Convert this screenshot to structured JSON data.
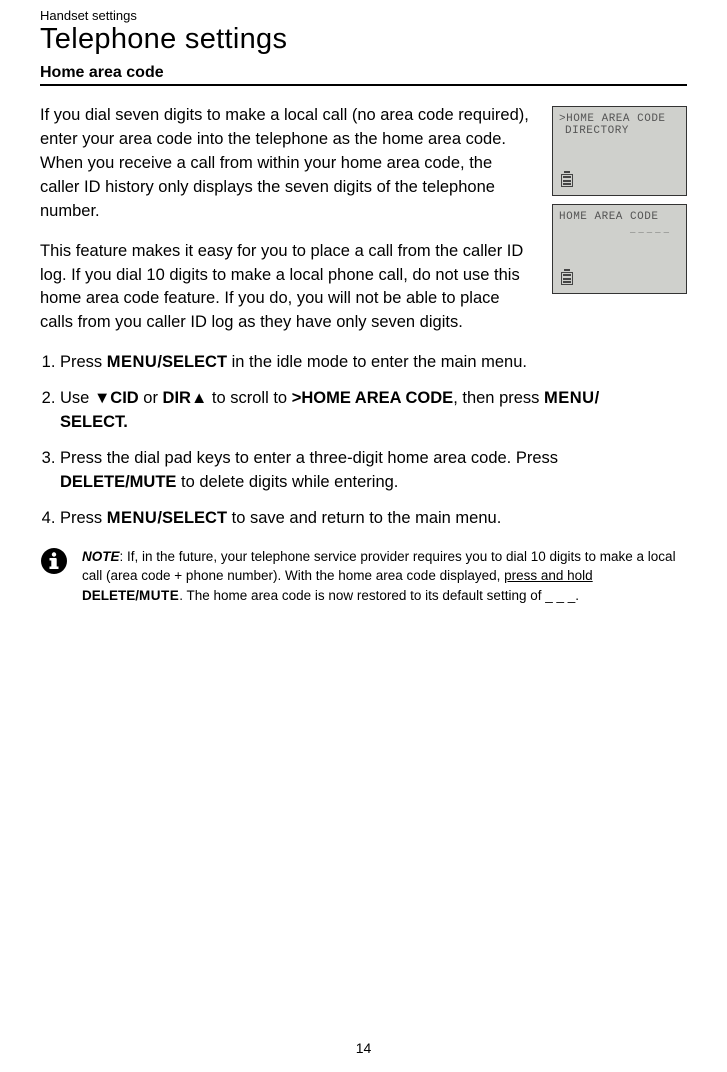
{
  "breadcrumb": "Handset settings",
  "title": "Telephone settings",
  "section": "Home area code",
  "paras": {
    "p1": "If you dial seven digits to make a local call (no area code required), enter your area code into the telephone as the home area code. When you receive a call from within your home area code, the caller ID history only displays the seven digits of the telephone number.",
    "p2": "This feature makes it easy for you to place a call from the caller ID log. If you dial 10 digits to make a local phone call, do not use this home area code feature. If you do, you will not be able to place calls from you caller ID log as they have only seven digits."
  },
  "screens": {
    "s1": {
      "line1": ">HOME AREA CODE",
      "line2": "DIRECTORY"
    },
    "s2": {
      "line1": "HOME AREA CODE",
      "entry": "_____"
    }
  },
  "steps": {
    "s1_a": "Press ",
    "s1_b": "MENU",
    "s1_c": "/SELECT",
    "s1_d": " in the idle mode to enter the main menu.",
    "s2_a": "Use ",
    "s2_cid": "CID",
    "s2_b": " or ",
    "s2_dir": "DIR",
    "s2_c": " to scroll to ",
    "s2_target": ">HOME AREA CODE",
    "s2_d": ", then press ",
    "s2_menu": "MENU",
    "s2_e": "/",
    "s2_sel": "SELECT.",
    "s3_a": "Press the dial pad keys to enter a three-digit home area code. Press ",
    "s3_del": "DELETE/MUTE",
    "s3_b": " to delete digits while entering.",
    "s4_a": "Press ",
    "s4_menu": "MENU",
    "s4_sel": "/SELECT",
    "s4_b": " to save and return to the main menu."
  },
  "note": {
    "label": "NOTE",
    "a": ": If, in the future, your telephone service provider requires you to dial 10 digits to make a local call (area code + phone number). With the home area code displayed, ",
    "ul": "press and hold",
    "b": " ",
    "del": "DELETE/",
    "mute": "MUTE",
    "c": ". The home area code is now restored to its default setting of _ _ _."
  },
  "pageno": "14"
}
